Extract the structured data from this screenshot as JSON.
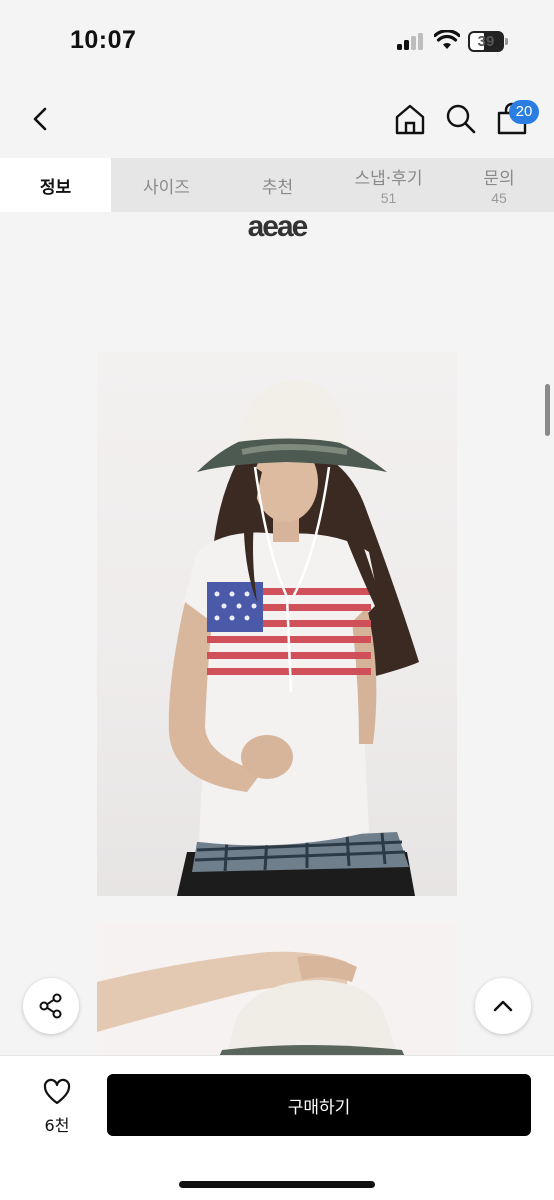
{
  "status_bar": {
    "time": "10:07",
    "battery_level": "39",
    "icons": [
      "cellular-signal-icon",
      "wifi-icon",
      "battery-icon"
    ]
  },
  "nav": {
    "icons": [
      "back-chevron-icon",
      "home-icon",
      "search-icon",
      "shopping-bag-icon"
    ],
    "cart_count": "20"
  },
  "tabs": [
    {
      "label": "정보",
      "count": "",
      "active": true
    },
    {
      "label": "사이즈",
      "count": ""
    },
    {
      "label": "추천",
      "count": ""
    },
    {
      "label": "스냅·후기",
      "count": "51"
    },
    {
      "label": "문의",
      "count": "45"
    }
  ],
  "content": {
    "brand_logo": "aeae"
  },
  "floating": {
    "icons": [
      "share-icon",
      "chevron-up-icon"
    ]
  },
  "bottom_bar": {
    "like_count": "6천",
    "buy_label": "구매하기",
    "icons": [
      "heart-icon"
    ]
  },
  "colors": {
    "accent_badge": "#2a7de1",
    "buy_button": "#000000",
    "active_tab_bg": "#ffffff",
    "tab_bar_bg": "#e6e6e6"
  }
}
